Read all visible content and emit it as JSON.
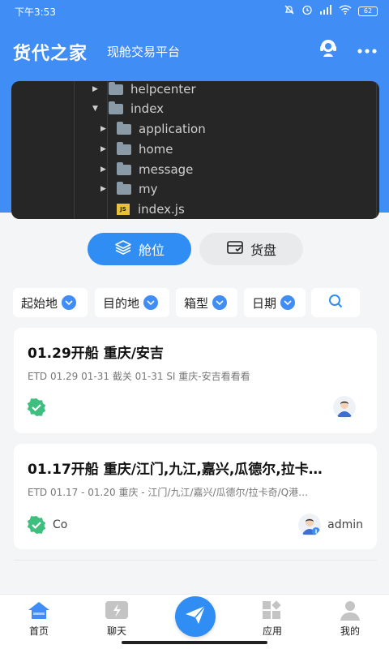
{
  "status_bar": {
    "time": "下午3:53",
    "battery": "62"
  },
  "header": {
    "title": "货代之家",
    "subtitle": "现舱交易平台"
  },
  "banner": {
    "tree": [
      {
        "label": "helpcenter",
        "type": "folder",
        "expanded": false
      },
      {
        "label": "index",
        "type": "folder",
        "expanded": true
      },
      {
        "label": "application",
        "type": "folder",
        "expanded": false
      },
      {
        "label": "home",
        "type": "folder",
        "expanded": false
      },
      {
        "label": "message",
        "type": "folder",
        "expanded": false
      },
      {
        "label": "my",
        "type": "folder",
        "expanded": false
      },
      {
        "label": "index.js",
        "type": "file",
        "icon": "JS"
      }
    ]
  },
  "tabs": [
    {
      "label": "舱位",
      "active": true
    },
    {
      "label": "货盘",
      "active": false
    }
  ],
  "filters": [
    {
      "label": "起始地"
    },
    {
      "label": "目的地"
    },
    {
      "label": "箱型"
    },
    {
      "label": "日期"
    }
  ],
  "cards": [
    {
      "title": "01.29开船 重庆/安吉",
      "desc": "ETD 01.29 01-31 截关 01-31 SI 重庆-安吉看看看",
      "company": "",
      "owner": ""
    },
    {
      "title": "01.17开船 重庆/江门,九江,嘉兴,瓜德尔,拉卡…",
      "desc": "ETD 01.17 - 01.20 重庆 - 江门/九江/嘉兴/瓜德尔/拉卡奇/Q港…",
      "company": "Co",
      "owner": "admin"
    }
  ],
  "bottom_nav": [
    {
      "label": "首页",
      "icon": "home-icon"
    },
    {
      "label": "聊天",
      "icon": "chat-icon"
    },
    {
      "label": "",
      "icon": "send-icon"
    },
    {
      "label": "应用",
      "icon": "apps-icon"
    },
    {
      "label": "我的",
      "icon": "user-icon"
    }
  ],
  "colors": {
    "primary": "#3f8df5",
    "verified": "#3fbf7f"
  }
}
